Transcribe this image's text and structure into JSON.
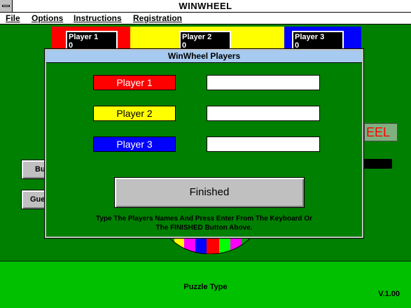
{
  "window": {
    "title": "WINWHEEL"
  },
  "menu": {
    "items": [
      {
        "label": "File"
      },
      {
        "label": "Options"
      },
      {
        "label": "Instructions"
      },
      {
        "label": "Registration"
      }
    ]
  },
  "board": {
    "player_boxes": [
      {
        "name": "Player 1",
        "score": "0"
      },
      {
        "name": "Player 2",
        "score": "0"
      },
      {
        "name": "Player 3",
        "score": "0"
      }
    ],
    "side_buttons": [
      {
        "label": "Bu"
      },
      {
        "label": "Gue"
      }
    ],
    "logo_fragment": "EEL",
    "puzzle_type_label": "Puzzle Type",
    "version": "V.1.00"
  },
  "dialog": {
    "title": "WinWheel Players",
    "players": [
      {
        "label": "Player 1",
        "color": "#ff0000",
        "text_color": "#ffffff",
        "value": ""
      },
      {
        "label": "Player 2",
        "color": "#ffff00",
        "text_color": "#000000",
        "value": ""
      },
      {
        "label": "Player 3",
        "color": "#0000ff",
        "text_color": "#ffffff",
        "value": ""
      }
    ],
    "finished_label": "Finished",
    "instruction_line1": "Type The Players Names And Press Enter From The Keyboard Or",
    "instruction_line2": "The FINISHED Button Above."
  },
  "colors": {
    "background": "#008000",
    "bottom_panel": "#00c000",
    "dialog_title": "#a6caf0"
  }
}
